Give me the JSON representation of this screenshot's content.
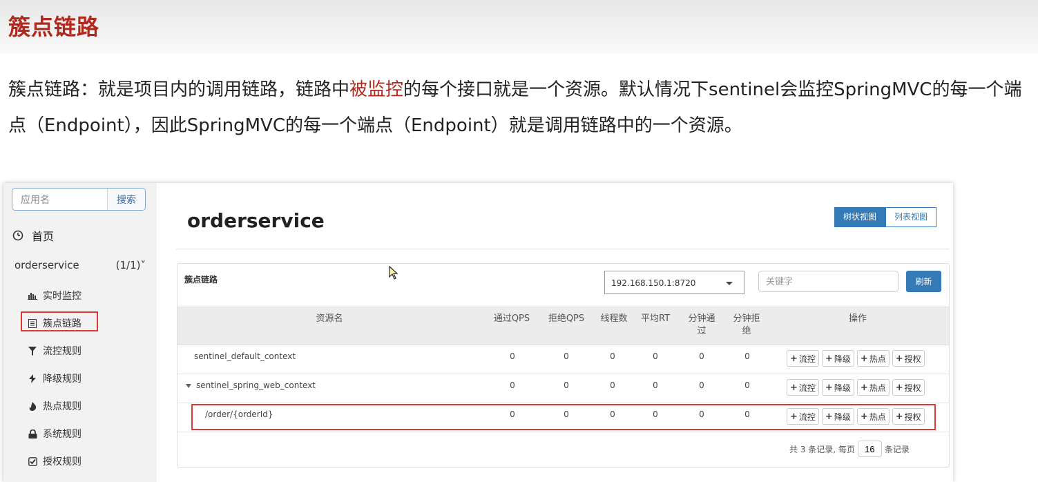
{
  "slide": {
    "title": "簇点链路",
    "text_part1": "簇点链路：就是项目内的调用链路，链路中",
    "text_highlight": "被监控",
    "text_part2": "的每个接口就是一个资源。默认情况下sentinel会监控SpringMVC的每一个端点（Endpoint），因此SpringMVC的每一个端点（Endpoint）就是调用链路中的一个资源。"
  },
  "sidebar": {
    "search_placeholder": "应用名",
    "search_button": "搜索",
    "home_label": "首页",
    "app_name": "orderservice",
    "app_count": "(1/1)",
    "items": [
      {
        "label": "实时监控",
        "icon": "bar-chart-icon"
      },
      {
        "label": "簇点链路",
        "icon": "list-icon"
      },
      {
        "label": "流控规则",
        "icon": "filter-icon"
      },
      {
        "label": "降级规则",
        "icon": "bolt-icon"
      },
      {
        "label": "热点规则",
        "icon": "fire-icon"
      },
      {
        "label": "系统规则",
        "icon": "lock-icon"
      },
      {
        "label": "授权规则",
        "icon": "check-icon"
      }
    ]
  },
  "main": {
    "app_title": "orderservice",
    "view_tree": "树状视图",
    "view_list": "列表视图",
    "card_label": "簇点链路",
    "machine": "192.168.150.1:8720",
    "keyword_placeholder": "关键字",
    "refresh": "刷新"
  },
  "table": {
    "headers": {
      "resource": "资源名",
      "pass_qps": "通过QPS",
      "block_qps": "拒绝QPS",
      "threads": "线程数",
      "avg_rt": "平均RT",
      "minute_pass": "分钟通过",
      "minute_block": "分钟拒绝",
      "ops": "操作"
    },
    "rows": [
      {
        "name": "sentinel_default_context",
        "pass_qps": "0",
        "block_qps": "0",
        "threads": "0",
        "avg_rt": "0",
        "minute_pass": "0",
        "minute_block": "0"
      },
      {
        "name": "sentinel_spring_web_context",
        "pass_qps": "0",
        "block_qps": "0",
        "threads": "0",
        "avg_rt": "0",
        "minute_pass": "0",
        "minute_block": "0"
      },
      {
        "name": "/order/{orderId}",
        "pass_qps": "0",
        "block_qps": "0",
        "threads": "0",
        "avg_rt": "0",
        "minute_pass": "0",
        "minute_block": "0"
      }
    ],
    "op_buttons": [
      "流控",
      "降级",
      "热点",
      "授权"
    ],
    "pager": {
      "prefix": "共 3 条记录, 每页",
      "page_size": "16",
      "suffix": "条记录"
    }
  },
  "colors": {
    "accent": "#337ab7",
    "title_red": "#b0281e",
    "highlight_red": "#d93a33"
  }
}
